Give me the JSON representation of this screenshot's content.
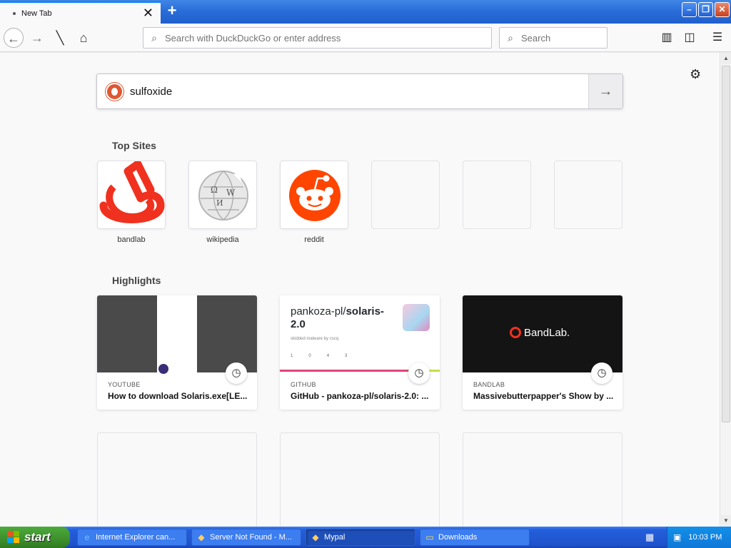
{
  "tab": {
    "title": "New Tab",
    "close": "✕",
    "new_tab": "+"
  },
  "window_controls": {
    "minimize": "–",
    "restore": "❐",
    "close": "✕"
  },
  "toolbar": {
    "back_icon": "←",
    "forward_icon": "→",
    "stop_icon": "╲",
    "home_icon": "⌂",
    "url_placeholder": "Search with DuckDuckGo or enter address",
    "search_placeholder": "Search",
    "library_icon": "▥",
    "sidebar_icon": "◫",
    "menu_icon": "☰"
  },
  "newtab": {
    "settings_icon": "⚙",
    "search_query": "sulfoxide",
    "go_icon": "→",
    "top_sites_title": "Top Sites",
    "top_sites": [
      {
        "label": "bandlab",
        "icon": "bandlab-logo",
        "color": "#f0311f"
      },
      {
        "label": "wikipedia",
        "icon": "wikipedia-globe",
        "color": "#999999"
      },
      {
        "label": "reddit",
        "icon": "reddit-alien",
        "color": "#ff4500"
      }
    ],
    "highlights_title": "Highlights",
    "highlights": [
      {
        "source": "YOUTUBE",
        "title": "How to download Solaris.exe[LE..."
      },
      {
        "source": "GITHUB",
        "title": "GitHub - pankoza-pl/solaris-2.0: ...",
        "thumb_repo_owner": "pankoza-pl/",
        "thumb_repo_name": "solaris-",
        "thumb_repo_ver": "2.0",
        "thumb_desc": "skidded malware by cscq",
        "thumb_stats": [
          "1",
          "0",
          "4",
          "3"
        ]
      },
      {
        "source": "BANDLAB",
        "title": "Massivebutterpapper's Show by ...",
        "thumb_brand": "BandLab."
      }
    ]
  },
  "taskbar": {
    "start_label": "start",
    "tasks": [
      {
        "label": "Internet Explorer can...",
        "icon": "e"
      },
      {
        "label": "Server Not Found - M...",
        "icon": "◆"
      },
      {
        "label": "Mypal",
        "icon": "◆"
      },
      {
        "label": "Downloads",
        "icon": "▭"
      }
    ],
    "clock": "10:03 PM"
  }
}
